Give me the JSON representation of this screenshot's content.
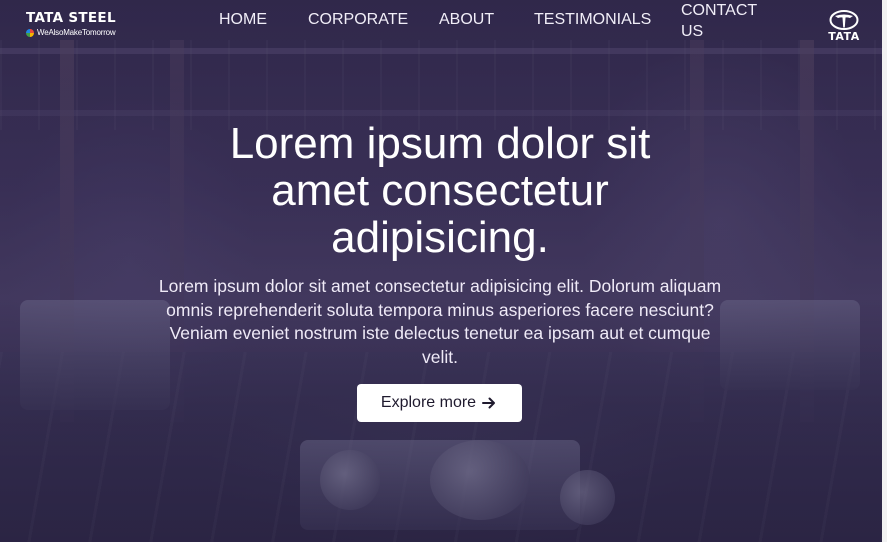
{
  "brand": {
    "name": "TATA STEEL",
    "tagline": "WeAlsoMakeTomorrow",
    "logo_word": "TATA"
  },
  "nav": {
    "items": [
      {
        "label": "HOME"
      },
      {
        "label": "CORPORATE"
      },
      {
        "label": "ABOUT"
      },
      {
        "label": "TESTIMONIALS"
      },
      {
        "label": "CONTACT US"
      }
    ]
  },
  "hero": {
    "title": "Lorem ipsum dolor sit amet consectetur adipisicing.",
    "text": "Lorem ipsum dolor sit amet consectetur adipisicing elit. Dolorum aliquam omnis reprehenderit soluta tempora minus asperiores facere nesciunt? Veniam eveniet nostrum iste delectus tenetur ea ipsam aut et cumque velit.",
    "cta_label": "Explore more"
  },
  "icons": {
    "cta": "arrow-right-icon",
    "logo": "tata-logo-icon",
    "tagline": "multicolor-dot-icon"
  },
  "colors": {
    "overlay": "#2d2346",
    "text": "#ffffff",
    "button_bg": "#ffffff",
    "button_text": "#1f1a2e"
  }
}
